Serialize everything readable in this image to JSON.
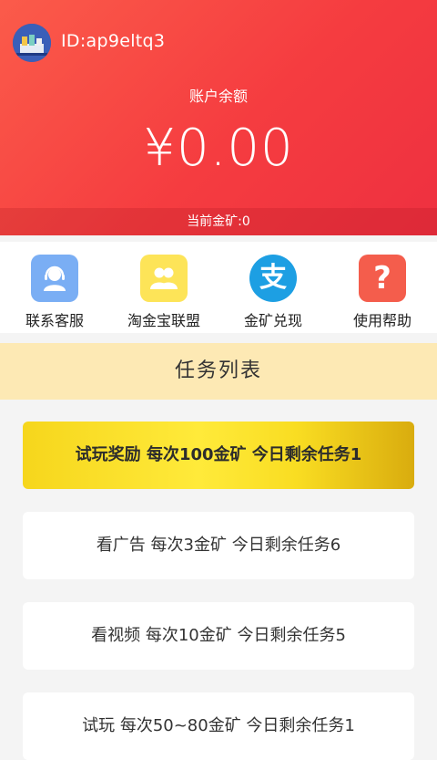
{
  "colors": {
    "header": "#f53c40",
    "task_banner": "#fde9b4",
    "featured_task": "#ffe33a",
    "cs_icon": "#7aaef4",
    "alliance_icon": "#fde458",
    "exchange_icon": "#1d9fe3",
    "help_icon": "#f45d4c"
  },
  "header": {
    "user_id": "ID:ap9eltq3",
    "balance_label": "账户余额",
    "balance": "¥0.00",
    "gold": "当前金矿:0"
  },
  "shortcuts": [
    {
      "label": "联系客服",
      "icon": "customer-service-icon"
    },
    {
      "label": "淘金宝联盟",
      "icon": "group-icon"
    },
    {
      "label": "金矿兑现",
      "icon": "alipay-icon",
      "glyph": "支"
    },
    {
      "label": "使用帮助",
      "icon": "question-icon",
      "glyph": "?"
    }
  ],
  "task_list": {
    "title": "任务列表",
    "tasks": [
      {
        "text": "试玩奖励  每次100金矿   今日剩余任务1",
        "featured": true
      },
      {
        "text": "看广告  每次3金矿   今日剩余任务6"
      },
      {
        "text": "看视频  每次10金矿   今日剩余任务5"
      },
      {
        "text": "试玩  每次50~80金矿   今日剩余任务1"
      }
    ]
  }
}
